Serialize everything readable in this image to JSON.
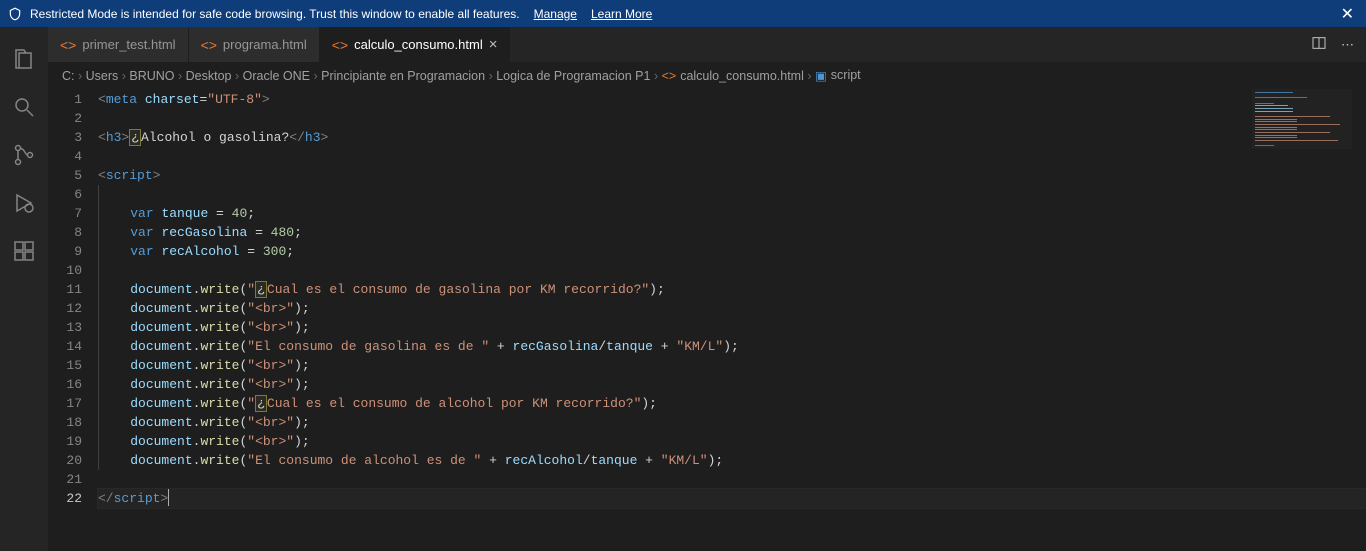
{
  "notification": {
    "text": "Restricted Mode is intended for safe code browsing. Trust this window to enable all features.",
    "manage": "Manage",
    "learn_more": "Learn More"
  },
  "tabs": [
    {
      "label": "primer_test.html",
      "active": false
    },
    {
      "label": "programa.html",
      "active": false
    },
    {
      "label": "calculo_consumo.html",
      "active": true
    }
  ],
  "breadcrumb": {
    "parts": [
      "C:",
      "Users",
      "BRUNO",
      "Desktop",
      "Oracle ONE",
      "Principiante en Programacion",
      "Logica de Programacion P1"
    ],
    "file": "calculo_consumo.html",
    "symbol": "script"
  },
  "code": {
    "lines": [
      {
        "n": 1,
        "tokens": [
          {
            "t": "<",
            "c": "tk-pun"
          },
          {
            "t": "meta",
            "c": "tk-tag"
          },
          {
            "t": " "
          },
          {
            "t": "charset",
            "c": "tk-attr"
          },
          {
            "t": "="
          },
          {
            "t": "\"UTF-8\"",
            "c": "tk-str"
          },
          {
            "t": ">",
            "c": "tk-pun"
          }
        ]
      },
      {
        "n": 2,
        "tokens": []
      },
      {
        "n": 3,
        "tokens": [
          {
            "t": "<",
            "c": "tk-pun"
          },
          {
            "t": "h3",
            "c": "tk-tag"
          },
          {
            "t": ">",
            "c": "tk-pun"
          },
          {
            "t": "¿",
            "c": "hl-box"
          },
          {
            "t": "Alcohol o gasolina?",
            "c": ""
          },
          {
            "t": "</",
            "c": "tk-pun"
          },
          {
            "t": "h3",
            "c": "tk-tag"
          },
          {
            "t": ">",
            "c": "tk-pun"
          }
        ]
      },
      {
        "n": 4,
        "tokens": []
      },
      {
        "n": 5,
        "tokens": [
          {
            "t": "<",
            "c": "tk-pun"
          },
          {
            "t": "script",
            "c": "tk-tag"
          },
          {
            "t": ">",
            "c": "tk-pun"
          }
        ]
      },
      {
        "n": 6,
        "tokens": [
          {
            "t": "    ",
            "guide": true
          }
        ]
      },
      {
        "n": 7,
        "tokens": [
          {
            "t": "    ",
            "guide": true
          },
          {
            "t": "var",
            "c": "tk-key"
          },
          {
            "t": " "
          },
          {
            "t": "tanque",
            "c": "tk-var"
          },
          {
            "t": " = "
          },
          {
            "t": "40",
            "c": "tk-num"
          },
          {
            "t": ";"
          }
        ]
      },
      {
        "n": 8,
        "tokens": [
          {
            "t": "    ",
            "guide": true
          },
          {
            "t": "var",
            "c": "tk-key"
          },
          {
            "t": " "
          },
          {
            "t": "recGasolina",
            "c": "tk-var"
          },
          {
            "t": " = "
          },
          {
            "t": "480",
            "c": "tk-num"
          },
          {
            "t": ";"
          }
        ]
      },
      {
        "n": 9,
        "tokens": [
          {
            "t": "    ",
            "guide": true
          },
          {
            "t": "var",
            "c": "tk-key"
          },
          {
            "t": " "
          },
          {
            "t": "recAlcohol",
            "c": "tk-var"
          },
          {
            "t": " = "
          },
          {
            "t": "300",
            "c": "tk-num"
          },
          {
            "t": ";"
          }
        ]
      },
      {
        "n": 10,
        "tokens": [
          {
            "t": "    ",
            "guide": true
          }
        ]
      },
      {
        "n": 11,
        "tokens": [
          {
            "t": "    ",
            "guide": true
          },
          {
            "t": "document",
            "c": "tk-var"
          },
          {
            "t": "."
          },
          {
            "t": "write",
            "c": "tk-fn"
          },
          {
            "t": "("
          },
          {
            "t": "\"",
            "c": "tk-str"
          },
          {
            "t": "¿",
            "c": "hl-box"
          },
          {
            "t": "Cual es el consumo de gasolina por KM recorrido?\"",
            "c": "tk-str"
          },
          {
            "t": ");"
          }
        ]
      },
      {
        "n": 12,
        "tokens": [
          {
            "t": "    ",
            "guide": true
          },
          {
            "t": "document",
            "c": "tk-var"
          },
          {
            "t": "."
          },
          {
            "t": "write",
            "c": "tk-fn"
          },
          {
            "t": "("
          },
          {
            "t": "\"<br>\"",
            "c": "tk-str"
          },
          {
            "t": ");"
          }
        ]
      },
      {
        "n": 13,
        "tokens": [
          {
            "t": "    ",
            "guide": true
          },
          {
            "t": "document",
            "c": "tk-var"
          },
          {
            "t": "."
          },
          {
            "t": "write",
            "c": "tk-fn"
          },
          {
            "t": "("
          },
          {
            "t": "\"<br>\"",
            "c": "tk-str"
          },
          {
            "t": ");"
          }
        ]
      },
      {
        "n": 14,
        "tokens": [
          {
            "t": "    ",
            "guide": true
          },
          {
            "t": "document",
            "c": "tk-var"
          },
          {
            "t": "."
          },
          {
            "t": "write",
            "c": "tk-fn"
          },
          {
            "t": "("
          },
          {
            "t": "\"El consumo de gasolina es de \"",
            "c": "tk-str"
          },
          {
            "t": " + "
          },
          {
            "t": "recGasolina",
            "c": "tk-var"
          },
          {
            "t": "/"
          },
          {
            "t": "tanque",
            "c": "tk-var"
          },
          {
            "t": " + "
          },
          {
            "t": "\"KM/L\"",
            "c": "tk-str"
          },
          {
            "t": ");"
          }
        ]
      },
      {
        "n": 15,
        "tokens": [
          {
            "t": "    ",
            "guide": true
          },
          {
            "t": "document",
            "c": "tk-var"
          },
          {
            "t": "."
          },
          {
            "t": "write",
            "c": "tk-fn"
          },
          {
            "t": "("
          },
          {
            "t": "\"<br>\"",
            "c": "tk-str"
          },
          {
            "t": ");"
          }
        ]
      },
      {
        "n": 16,
        "tokens": [
          {
            "t": "    ",
            "guide": true
          },
          {
            "t": "document",
            "c": "tk-var"
          },
          {
            "t": "."
          },
          {
            "t": "write",
            "c": "tk-fn"
          },
          {
            "t": "("
          },
          {
            "t": "\"<br>\"",
            "c": "tk-str"
          },
          {
            "t": ");"
          }
        ]
      },
      {
        "n": 17,
        "tokens": [
          {
            "t": "    ",
            "guide": true
          },
          {
            "t": "document",
            "c": "tk-var"
          },
          {
            "t": "."
          },
          {
            "t": "write",
            "c": "tk-fn"
          },
          {
            "t": "("
          },
          {
            "t": "\"",
            "c": "tk-str"
          },
          {
            "t": "¿",
            "c": "hl-box"
          },
          {
            "t": "Cual es el consumo de alcohol por KM recorrido?\"",
            "c": "tk-str"
          },
          {
            "t": ");"
          }
        ]
      },
      {
        "n": 18,
        "tokens": [
          {
            "t": "    ",
            "guide": true
          },
          {
            "t": "document",
            "c": "tk-var"
          },
          {
            "t": "."
          },
          {
            "t": "write",
            "c": "tk-fn"
          },
          {
            "t": "("
          },
          {
            "t": "\"<br>\"",
            "c": "tk-str"
          },
          {
            "t": ");"
          }
        ]
      },
      {
        "n": 19,
        "tokens": [
          {
            "t": "    ",
            "guide": true
          },
          {
            "t": "document",
            "c": "tk-var"
          },
          {
            "t": "."
          },
          {
            "t": "write",
            "c": "tk-fn"
          },
          {
            "t": "("
          },
          {
            "t": "\"<br>\"",
            "c": "tk-str"
          },
          {
            "t": ");"
          }
        ]
      },
      {
        "n": 20,
        "tokens": [
          {
            "t": "    ",
            "guide": true
          },
          {
            "t": "document",
            "c": "tk-var"
          },
          {
            "t": "."
          },
          {
            "t": "write",
            "c": "tk-fn"
          },
          {
            "t": "("
          },
          {
            "t": "\"El consumo de alcohol es de \"",
            "c": "tk-str"
          },
          {
            "t": " + "
          },
          {
            "t": "recAlcohol",
            "c": "tk-var"
          },
          {
            "t": "/"
          },
          {
            "t": "tanque",
            "c": "tk-var"
          },
          {
            "t": " + "
          },
          {
            "t": "\"KM/L\"",
            "c": "tk-str"
          },
          {
            "t": ");"
          }
        ]
      },
      {
        "n": 21,
        "tokens": []
      },
      {
        "n": 22,
        "tokens": [
          {
            "t": "</",
            "c": "tk-pun"
          },
          {
            "t": "script",
            "c": "tk-tag"
          },
          {
            "t": ">",
            "c": "tk-pun"
          }
        ],
        "active": true,
        "cursor": true
      }
    ]
  }
}
